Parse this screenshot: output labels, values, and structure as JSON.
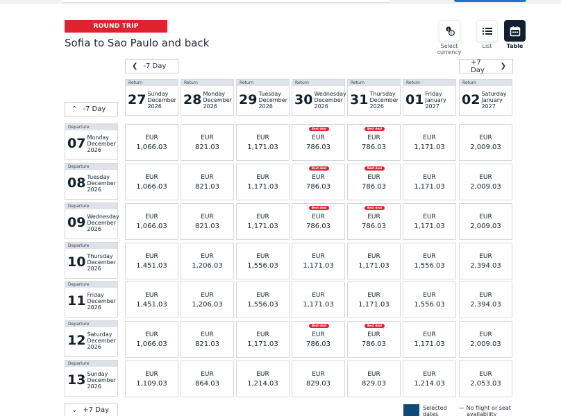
{
  "trip": {
    "badge": "ROUND TRIP",
    "route": "Sofia to Sao Paulo and back"
  },
  "views": {
    "currency": "Select currency",
    "list": "List",
    "table": "Table"
  },
  "nav": {
    "prev_return": "-7 Day",
    "next_return": "+7 Day",
    "prev_departure": "-7 Day",
    "next_departure": "+7 Day"
  },
  "labels": {
    "return": "Return",
    "departure": "Departure",
    "best_deal": "Best deal"
  },
  "returns": [
    {
      "day": "27",
      "weekday": "Sunday",
      "month": "December",
      "year": "2026"
    },
    {
      "day": "28",
      "weekday": "Monday",
      "month": "December",
      "year": "2026"
    },
    {
      "day": "29",
      "weekday": "Tuesday",
      "month": "December",
      "year": "2026"
    },
    {
      "day": "30",
      "weekday": "Wednesday",
      "month": "December",
      "year": "2026"
    },
    {
      "day": "31",
      "weekday": "Thursday",
      "month": "December",
      "year": "2026"
    },
    {
      "day": "01",
      "weekday": "Friday",
      "month": "January",
      "year": "2027"
    },
    {
      "day": "02",
      "weekday": "Saturday",
      "month": "January",
      "year": "2027"
    }
  ],
  "departures": [
    {
      "day": "07",
      "weekday": "Monday",
      "month": "December",
      "year": "2026"
    },
    {
      "day": "08",
      "weekday": "Tuesday",
      "month": "December",
      "year": "2026"
    },
    {
      "day": "09",
      "weekday": "Wednesday",
      "month": "December",
      "year": "2026"
    },
    {
      "day": "10",
      "weekday": "Thursday",
      "month": "December",
      "year": "2026"
    },
    {
      "day": "11",
      "weekday": "Friday",
      "month": "December",
      "year": "2026"
    },
    {
      "day": "12",
      "weekday": "Saturday",
      "month": "December",
      "year": "2026"
    },
    {
      "day": "13",
      "weekday": "Sunday",
      "month": "December",
      "year": "2026"
    }
  ],
  "prices": [
    [
      {
        "c": "EUR",
        "a": "1,066.03",
        "d": false
      },
      {
        "c": "EUR",
        "a": "821.03",
        "d": false
      },
      {
        "c": "EUR",
        "a": "1,171.03",
        "d": false
      },
      {
        "c": "EUR",
        "a": "786.03",
        "d": true
      },
      {
        "c": "EUR",
        "a": "786.03",
        "d": true
      },
      {
        "c": "EUR",
        "a": "1,171.03",
        "d": false
      },
      {
        "c": "EUR",
        "a": "2,009.03",
        "d": false
      }
    ],
    [
      {
        "c": "EUR",
        "a": "1,066.03",
        "d": false
      },
      {
        "c": "EUR",
        "a": "821.03",
        "d": false
      },
      {
        "c": "EUR",
        "a": "1,171.03",
        "d": false
      },
      {
        "c": "EUR",
        "a": "786.03",
        "d": true
      },
      {
        "c": "EUR",
        "a": "786.03",
        "d": true
      },
      {
        "c": "EUR",
        "a": "1,171.03",
        "d": false
      },
      {
        "c": "EUR",
        "a": "2,009.03",
        "d": false
      }
    ],
    [
      {
        "c": "EUR",
        "a": "1,066.03",
        "d": false
      },
      {
        "c": "EUR",
        "a": "821.03",
        "d": false
      },
      {
        "c": "EUR",
        "a": "1,171.03",
        "d": false
      },
      {
        "c": "EUR",
        "a": "786.03",
        "d": true
      },
      {
        "c": "EUR",
        "a": "786.03",
        "d": true
      },
      {
        "c": "EUR",
        "a": "1,171.03",
        "d": false
      },
      {
        "c": "EUR",
        "a": "2,009.03",
        "d": false
      }
    ],
    [
      {
        "c": "EUR",
        "a": "1,451.03",
        "d": false
      },
      {
        "c": "EUR",
        "a": "1,206.03",
        "d": false
      },
      {
        "c": "EUR",
        "a": "1,556.03",
        "d": false
      },
      {
        "c": "EUR",
        "a": "1,171.03",
        "d": false
      },
      {
        "c": "EUR",
        "a": "1,171.03",
        "d": false
      },
      {
        "c": "EUR",
        "a": "1,556.03",
        "d": false
      },
      {
        "c": "EUR",
        "a": "2,394.03",
        "d": false
      }
    ],
    [
      {
        "c": "EUR",
        "a": "1,451.03",
        "d": false
      },
      {
        "c": "EUR",
        "a": "1,206.03",
        "d": false
      },
      {
        "c": "EUR",
        "a": "1,556.03",
        "d": false
      },
      {
        "c": "EUR",
        "a": "1,171.03",
        "d": false
      },
      {
        "c": "EUR",
        "a": "1,171.03",
        "d": false
      },
      {
        "c": "EUR",
        "a": "1,556.03",
        "d": false
      },
      {
        "c": "EUR",
        "a": "2,394.03",
        "d": false
      }
    ],
    [
      {
        "c": "EUR",
        "a": "1,066.03",
        "d": false
      },
      {
        "c": "EUR",
        "a": "821.03",
        "d": false
      },
      {
        "c": "EUR",
        "a": "1,171.03",
        "d": false
      },
      {
        "c": "EUR",
        "a": "786.03",
        "d": true
      },
      {
        "c": "EUR",
        "a": "786.03",
        "d": true
      },
      {
        "c": "EUR",
        "a": "1,171.03",
        "d": false
      },
      {
        "c": "EUR",
        "a": "2,009.03",
        "d": false
      }
    ],
    [
      {
        "c": "EUR",
        "a": "1,109.03",
        "d": false
      },
      {
        "c": "EUR",
        "a": "864.03",
        "d": false
      },
      {
        "c": "EUR",
        "a": "1,214.03",
        "d": false
      },
      {
        "c": "EUR",
        "a": "829.03",
        "d": false
      },
      {
        "c": "EUR",
        "a": "829.03",
        "d": false
      },
      {
        "c": "EUR",
        "a": "1,214.03",
        "d": false
      },
      {
        "c": "EUR",
        "a": "2,053.03",
        "d": false
      }
    ]
  ],
  "legend": {
    "selected": [
      "Selected",
      "dates"
    ],
    "unavailable": [
      "— No flight or seat",
      "availability"
    ]
  },
  "colors": {
    "brand_red": "#e0222e",
    "navy": "#10202e",
    "selected": "#0c4a7a"
  }
}
